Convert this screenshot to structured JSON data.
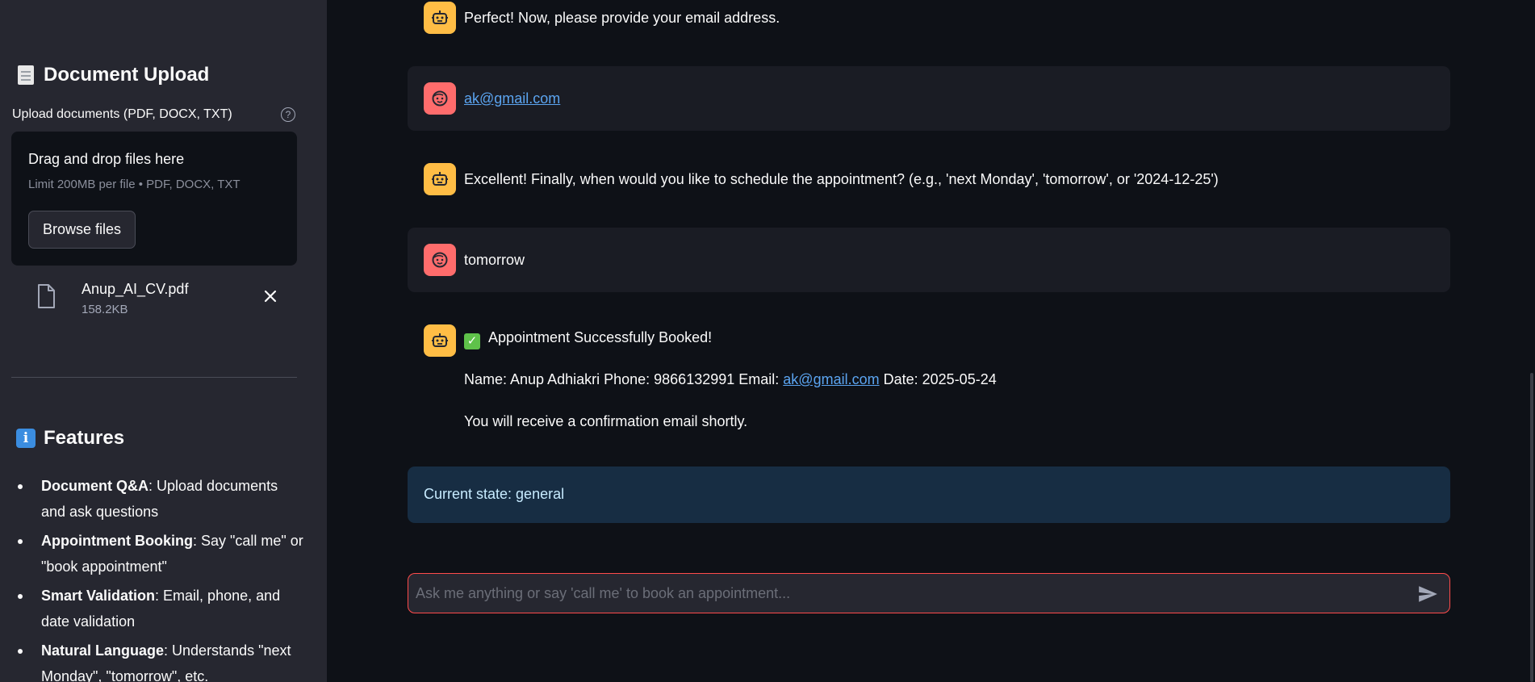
{
  "sidebar": {
    "upload_heading": "Document Upload",
    "upload_label": "Upload documents (PDF, DOCX, TXT)",
    "dropzone_title": "Drag and drop files here",
    "dropzone_limit": "Limit 200MB per file • PDF, DOCX, TXT",
    "browse_label": "Browse files",
    "file": {
      "name": "Anup_AI_CV.pdf",
      "size": "158.2KB"
    },
    "features_heading": "Features",
    "features": [
      {
        "title": "Document Q&A",
        "desc": ": Upload documents and ask questions"
      },
      {
        "title": "Appointment Booking",
        "desc": ": Say \"call me\" or \"book appointment\""
      },
      {
        "title": "Smart Validation",
        "desc": ": Email, phone, and date validation"
      },
      {
        "title": "Natural Language",
        "desc": ": Understands \"next Monday\", \"tomorrow\", etc."
      }
    ]
  },
  "chat": {
    "messages": [
      {
        "role": "assistant",
        "text": "Perfect! Now, please provide your email address."
      },
      {
        "role": "user",
        "text": "ak@gmail.com"
      },
      {
        "role": "assistant",
        "text": "Excellent! Finally, when would you like to schedule the appointment? (e.g., 'next Monday', 'tomorrow', or '2024-12-25')"
      },
      {
        "role": "user",
        "text": "tomorrow"
      },
      {
        "role": "assistant",
        "title": "Appointment Successfully Booked!",
        "details_prefix": "Name: Anup Adhiakri Phone: 9866132991 Email:",
        "details_email": "ak@gmail.com",
        "details_suffix": "Date: 2025-05-24",
        "footer": "You will receive a confirmation email shortly."
      }
    ],
    "state": "Current state: general",
    "input_placeholder": "Ask me anything or say 'call me' to book an appointment..."
  },
  "icons": {
    "assistant_avatar": "robot-icon",
    "user_avatar": "face-icon",
    "send": "send-icon",
    "help": "help-icon",
    "file": "file-icon",
    "close": "close-icon"
  },
  "colors": {
    "assistant_avatar": "#ffbd45",
    "user_avatar": "#ff6c6c",
    "link": "#5ba4f0",
    "input_border": "#ff4b4b",
    "state_bg": "#172d43"
  }
}
